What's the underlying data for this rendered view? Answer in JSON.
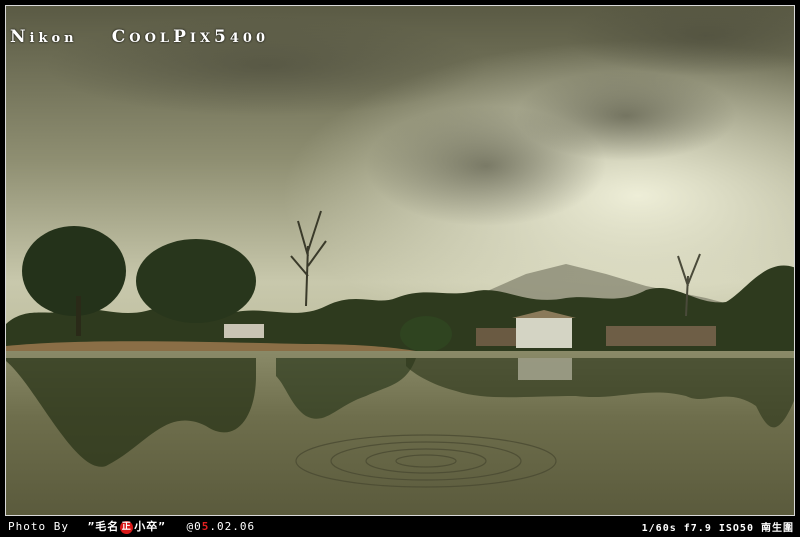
{
  "watermark": {
    "brand_n": "N",
    "brand_rest": "ikon",
    "model_c": "C",
    "model_ool": "OOL",
    "model_p": "P",
    "model_ix": "IX",
    "model_5": "5",
    "model_400": "400"
  },
  "caption": {
    "photo_by": "Photo By",
    "author_pre": "”毛名",
    "author_seal": "正",
    "author_post": "小卒”",
    "date_at": "@0",
    "date_red": "5",
    "date_rest": ".02.06",
    "exif": "1/60s f7.9 ISO50 南生圍"
  },
  "colors": {
    "sky_top": "#5e5e48",
    "sky_mid": "#a8a88a",
    "sky_glow": "#e6e6d0",
    "water": "#6f6f4c",
    "foliage": "#2a3a1c",
    "frame": "#000000"
  }
}
